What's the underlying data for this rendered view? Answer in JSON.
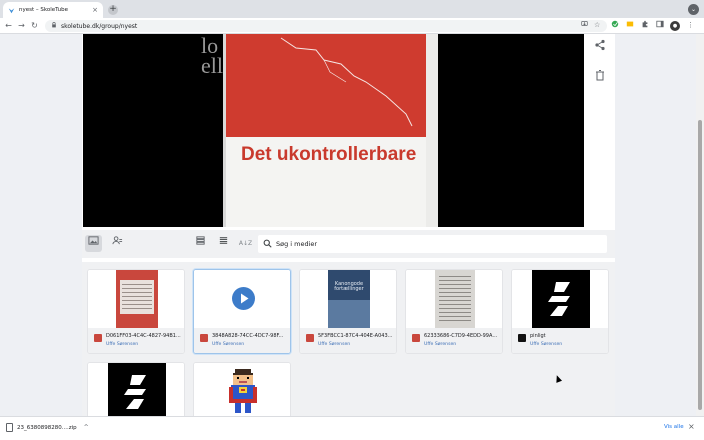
{
  "browser": {
    "tab_title": "nyest – SkoleTube",
    "tab_close": "×",
    "new_tab": "+",
    "window_menu": "⌄",
    "back": "←",
    "forward": "→",
    "reload": "↻",
    "url": "skoletube.dk/group/nyest",
    "avatar_initial": "●"
  },
  "player": {
    "book_title": "Det ukontrollerbare",
    "background_text": "lo\nell"
  },
  "filterbar": {
    "search_placeholder": "Søg i medier"
  },
  "media": [
    {
      "name": "D061FF03-4C4C-4827-94B1...",
      "owner": "Uffe Sørensen",
      "type_color": "#c9473d",
      "thumb": "book-red"
    },
    {
      "name": "3848A828-74CC-4DC7-98F...",
      "owner": "Uffe Sørensen",
      "type_color": "#c9473d",
      "thumb": "video"
    },
    {
      "name": "5F3FBCC1-87C4-404E-A043...",
      "owner": "Uffe Sørensen",
      "type_color": "#c9473d",
      "thumb": "book-blue",
      "thumb_text": "Kanongode fortællinger"
    },
    {
      "name": "62333686-C7D9-4EDD-99A1...",
      "owner": "Uffe Sørensen",
      "type_color": "#c9473d",
      "thumb": "book-page"
    },
    {
      "name": "pinligt",
      "owner": "Uffe Sørensen",
      "type_color": "#111111",
      "thumb": "logo"
    },
    {
      "name": "",
      "owner": "",
      "type_color": "#111111",
      "thumb": "logo"
    },
    {
      "name": "",
      "owner": "",
      "type_color": "#111111",
      "thumb": "pixel"
    }
  ],
  "downloads": {
    "file_name": "23_6380898280....zip",
    "chevron": "^",
    "show_all": "Vis alle",
    "close": "×"
  }
}
